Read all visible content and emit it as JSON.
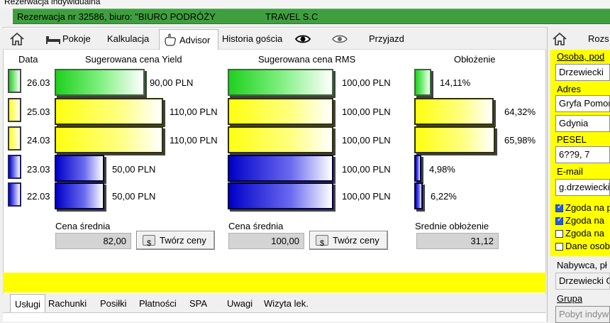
{
  "window": {
    "title": "Rezerwacja indywidualna"
  },
  "header": {
    "reservation": "Rezerwacja nr 32586, biuro: \"BIURO PODRÓŻY",
    "agency": "TRAVEL S.C"
  },
  "tabs_top": [
    {
      "label": "Pokoje",
      "icon": "bed-icon"
    },
    {
      "label": "Kalkulacja"
    },
    {
      "label": "Advisor",
      "icon": "hand-icon"
    },
    {
      "label": "Historia gościa"
    },
    {
      "label": "",
      "icon": "eye-icon"
    },
    {
      "label": "",
      "icon": "eye-outline-icon"
    },
    {
      "label": "Przyjazd"
    }
  ],
  "columns": {
    "date": "Data",
    "yield": "Sugerowana cena Yield",
    "rms": "Sugerowana cena RMS",
    "occupancy": "Obłożenie"
  },
  "rows": [
    {
      "date": "26.03",
      "level": "green",
      "yield": "90,00 PLN",
      "rms": "100,00 PLN",
      "occ": "14,11%"
    },
    {
      "date": "25.03",
      "level": "yellow",
      "yield": "110,00 PLN",
      "rms": "100,00 PLN",
      "occ": "64,32%"
    },
    {
      "date": "24.03",
      "level": "yellow",
      "yield": "110,00 PLN",
      "rms": "100,00 PLN",
      "occ": "65,98%"
    },
    {
      "date": "23.03",
      "level": "blue",
      "yield": "50,00 PLN",
      "rms": "100,00 PLN",
      "occ": "4,98%"
    },
    {
      "date": "22.03",
      "level": "blue",
      "yield": "50,00 PLN",
      "rms": "100,00 PLN",
      "occ": "6,22%"
    }
  ],
  "summary": {
    "yield_avg_label": "Cena średnia",
    "yield_avg": "82,00",
    "rms_avg_label": "Cena średnia",
    "rms_avg": "100,00",
    "occ_avg_label": "Srednie obłożenie",
    "occ_avg": "31,12",
    "create_prices": "Twórz ceny"
  },
  "tabs_bottom": [
    "Usługi",
    "Rachunki",
    "Posiłki",
    "Płatności",
    "SPA",
    "Uwagi",
    "Wizyta lek."
  ],
  "right_panel": {
    "tab": "Rozs",
    "person_label": "Osoba, pod",
    "person_value": "Drzewiecki",
    "address_label": "Adres",
    "street": "Gryfa Pomor",
    "city": "Gdynia",
    "pesel_label": "PESEL",
    "pesel_value": "6??9,       7",
    "email_label": "E-mail",
    "email_value": "g.drzewiecki",
    "consents": [
      {
        "label": "Zgoda na p",
        "checked": true
      },
      {
        "label": "Zgoda na",
        "checked": true
      },
      {
        "label": "Zgoda na",
        "checked": false
      },
      {
        "label": "Dane osob",
        "checked": false
      }
    ],
    "buyer_label": "Nabywca, pł",
    "buyer_value": "Drzewiecki G",
    "group_label": "Grupa",
    "group_value": "Pobyt indyw"
  },
  "colors": {
    "header_green": "#3f9f3f",
    "accent_yellow": "#ffff00",
    "bar_green": "#1fd01f",
    "bar_yellow": "#ffff10",
    "bar_blue": "#0000c8"
  }
}
